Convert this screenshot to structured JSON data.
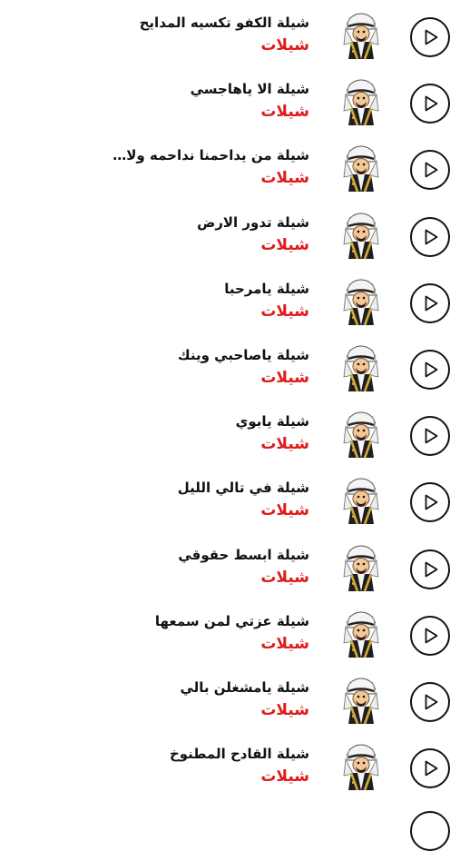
{
  "colors": {
    "title": "#111111",
    "category": "#e01919",
    "play_icon": "#111111",
    "background": "#ffffff"
  },
  "icons": {
    "play": "play-circle-icon",
    "avatar": "man-in-ghutra-avatar"
  },
  "tracks": [
    {
      "title": "شيلة  الكفو تكسيه المدايح",
      "category": "شيلات"
    },
    {
      "title": "شيلة  الا ياهاجسي",
      "category": "شيلات"
    },
    {
      "title": "شيلة  من يداحمنا نداحمه ولا…",
      "category": "شيلات"
    },
    {
      "title": "شيلة  تدور الارض",
      "category": "شيلات"
    },
    {
      "title": "شيلة  يامرحبا",
      "category": "شيلات"
    },
    {
      "title": "شيلة  ياصاحبي وينك",
      "category": "شيلات"
    },
    {
      "title": "شيلة  يابوي",
      "category": "شيلات"
    },
    {
      "title": "شيلة  في تالي الليل",
      "category": "شيلات"
    },
    {
      "title": "شيلة ابسط حقوقي",
      "category": "شيلات"
    },
    {
      "title": "شيلة  عزتي لمن سمعها",
      "category": "شيلات"
    },
    {
      "title": "شيلة يامشغلن بالي",
      "category": "شيلات"
    },
    {
      "title": "شيلة القادح المطنوخ",
      "category": "شيلات"
    }
  ]
}
